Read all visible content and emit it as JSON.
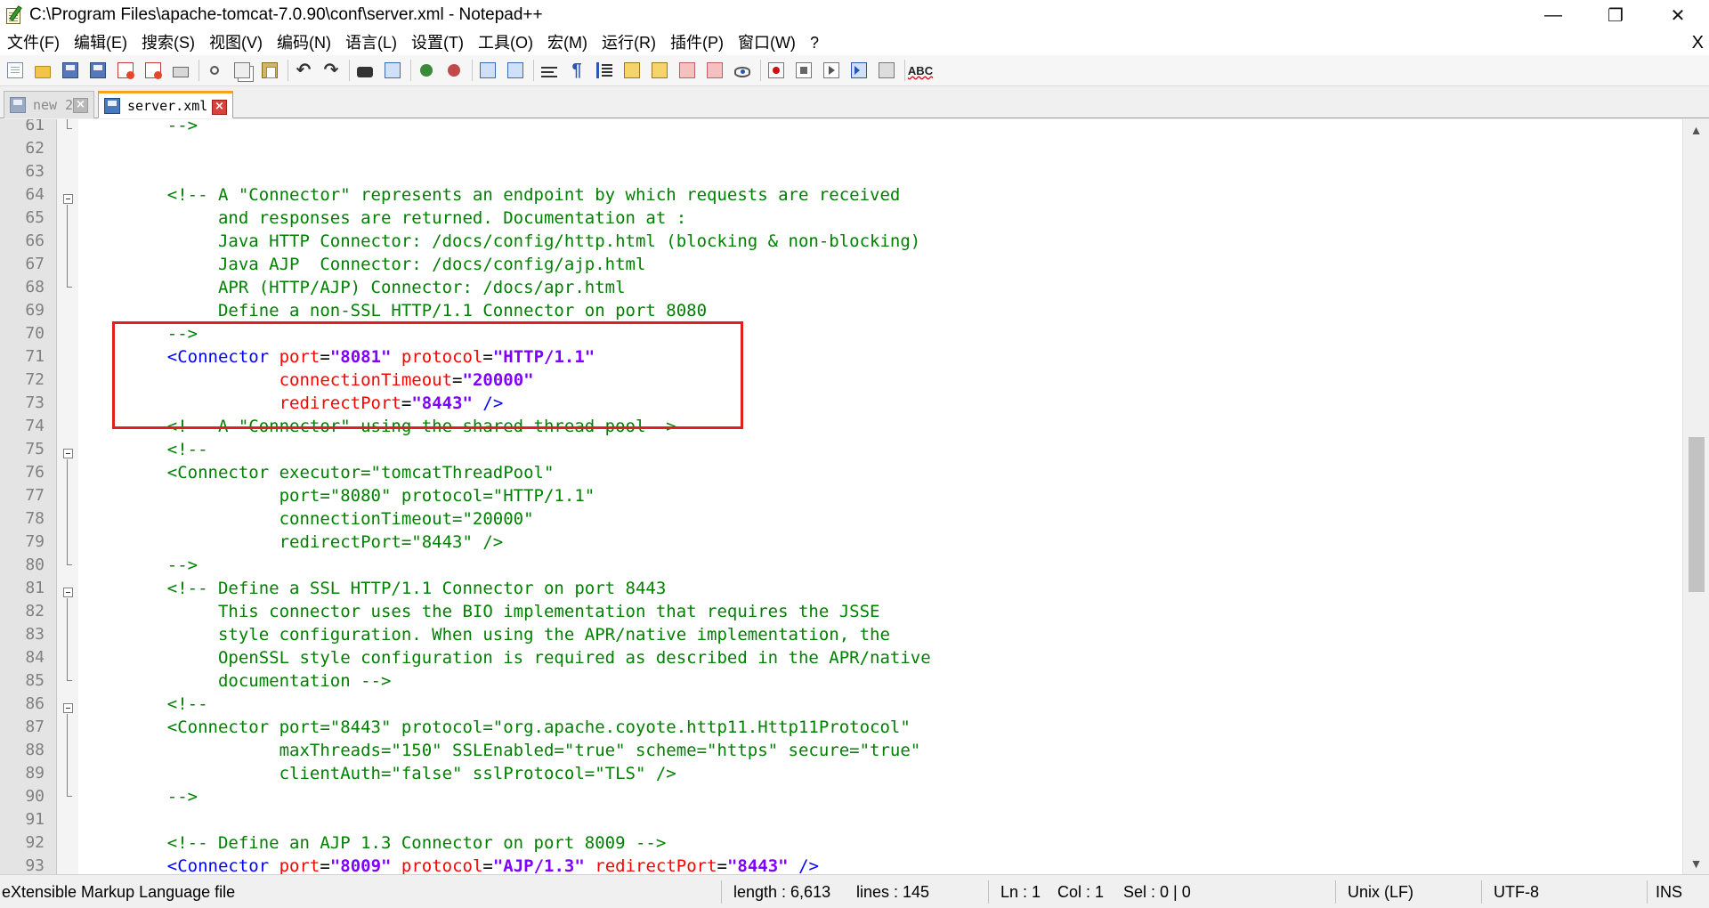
{
  "window": {
    "title": "C:\\Program Files\\apache-tomcat-7.0.90\\conf\\server.xml - Notepad++",
    "minimize": "—",
    "restore": "❐",
    "close": "✕"
  },
  "menu": {
    "items": [
      "文件(F)",
      "编辑(E)",
      "搜索(S)",
      "视图(V)",
      "编码(N)",
      "语言(L)",
      "设置(T)",
      "工具(O)",
      "宏(M)",
      "运行(R)",
      "插件(P)",
      "窗口(W)",
      "?"
    ],
    "close": "X"
  },
  "toolbar": {
    "spellcheck_label": "ABC",
    "buttons": [
      "new-file",
      "open-file",
      "save",
      "save-all",
      "close",
      "close-all",
      "print",
      "cut",
      "copy",
      "paste",
      "undo",
      "redo",
      "find",
      "replace",
      "zoom-in",
      "zoom-out",
      "sync-vertical",
      "sync-horizontal",
      "word-wrap",
      "show-all-chars",
      "indent-guide",
      "doc-map",
      "function-list",
      "folder-as-workspace",
      "monitoring",
      "preview",
      "record-macro",
      "stop-recording",
      "play-macro",
      "run-macro-multiple",
      "save-macro",
      "spell-check"
    ]
  },
  "tabs": [
    {
      "label": "new 2",
      "active": false
    },
    {
      "label": "server.xml",
      "active": true
    }
  ],
  "editor": {
    "lines": [
      {
        "n": "61",
        "segs": [
          {
            "t": "    -->",
            "c": "comment"
          }
        ]
      },
      {
        "n": "62",
        "segs": []
      },
      {
        "n": "63",
        "segs": []
      },
      {
        "n": "64",
        "segs": [
          {
            "t": "    <!-- A \"Connector\" represents an endpoint by which requests are received",
            "c": "comment"
          }
        ]
      },
      {
        "n": "65",
        "segs": [
          {
            "t": "         and responses are returned. Documentation at :",
            "c": "comment"
          }
        ]
      },
      {
        "n": "66",
        "segs": [
          {
            "t": "         Java HTTP Connector: /docs/config/http.html (blocking & non-blocking)",
            "c": "comment"
          }
        ]
      },
      {
        "n": "67",
        "segs": [
          {
            "t": "         Java AJP  Connector: /docs/config/ajp.html",
            "c": "comment"
          }
        ]
      },
      {
        "n": "68",
        "segs": [
          {
            "t": "         APR (HTTP/AJP) Connector: /docs/apr.html",
            "c": "comment"
          }
        ]
      },
      {
        "n": "69",
        "segs": [
          {
            "t": "         Define a non-SSL HTTP/1.1 Connector on port 8080",
            "c": "comment"
          }
        ]
      },
      {
        "n": "70",
        "segs": [
          {
            "t": "    -->",
            "c": "comment"
          }
        ]
      },
      {
        "n": "71",
        "segs": [
          {
            "t": "    <Connector",
            "c": "tag"
          },
          {
            "t": " port",
            "c": "attr"
          },
          {
            "t": "=",
            "c": "plain"
          },
          {
            "t": "\"8081\"",
            "c": "val"
          },
          {
            "t": " protocol",
            "c": "attr"
          },
          {
            "t": "=",
            "c": "plain"
          },
          {
            "t": "\"HTTP/1.1\"",
            "c": "val"
          }
        ]
      },
      {
        "n": "72",
        "segs": [
          {
            "t": "               connectionTimeout",
            "c": "attr"
          },
          {
            "t": "=",
            "c": "plain"
          },
          {
            "t": "\"20000\"",
            "c": "val"
          }
        ]
      },
      {
        "n": "73",
        "segs": [
          {
            "t": "               redirectPort",
            "c": "attr"
          },
          {
            "t": "=",
            "c": "plain"
          },
          {
            "t": "\"8443\"",
            "c": "val"
          },
          {
            "t": " />",
            "c": "tag"
          }
        ]
      },
      {
        "n": "74",
        "segs": [
          {
            "t": "    <!-- A \"Connector\" using the shared thread pool-->",
            "c": "comment"
          }
        ]
      },
      {
        "n": "75",
        "segs": [
          {
            "t": "    <!--",
            "c": "comment"
          }
        ]
      },
      {
        "n": "76",
        "segs": [
          {
            "t": "    <Connector executor=\"tomcatThreadPool\"",
            "c": "comment"
          }
        ]
      },
      {
        "n": "77",
        "segs": [
          {
            "t": "               port=\"8080\" protocol=\"HTTP/1.1\"",
            "c": "comment"
          }
        ]
      },
      {
        "n": "78",
        "segs": [
          {
            "t": "               connectionTimeout=\"20000\"",
            "c": "comment"
          }
        ]
      },
      {
        "n": "79",
        "segs": [
          {
            "t": "               redirectPort=\"8443\" />",
            "c": "comment"
          }
        ]
      },
      {
        "n": "80",
        "segs": [
          {
            "t": "    -->",
            "c": "comment"
          }
        ]
      },
      {
        "n": "81",
        "segs": [
          {
            "t": "    <!-- Define a SSL HTTP/1.1 Connector on port 8443",
            "c": "comment"
          }
        ]
      },
      {
        "n": "82",
        "segs": [
          {
            "t": "         This connector uses the BIO implementation that requires the JSSE",
            "c": "comment"
          }
        ]
      },
      {
        "n": "83",
        "segs": [
          {
            "t": "         style configuration. When using the APR/native implementation, the",
            "c": "comment"
          }
        ]
      },
      {
        "n": "84",
        "segs": [
          {
            "t": "         OpenSSL style configuration is required as described in the APR/native",
            "c": "comment"
          }
        ]
      },
      {
        "n": "85",
        "segs": [
          {
            "t": "         documentation -->",
            "c": "comment"
          }
        ]
      },
      {
        "n": "86",
        "segs": [
          {
            "t": "    <!--",
            "c": "comment"
          }
        ]
      },
      {
        "n": "87",
        "segs": [
          {
            "t": "    <Connector port=\"8443\" protocol=\"org.apache.coyote.http11.Http11Protocol\"",
            "c": "comment"
          }
        ]
      },
      {
        "n": "88",
        "segs": [
          {
            "t": "               maxThreads=\"150\" SSLEnabled=\"true\" scheme=\"https\" secure=\"true\"",
            "c": "comment"
          }
        ]
      },
      {
        "n": "89",
        "segs": [
          {
            "t": "               clientAuth=\"false\" sslProtocol=\"TLS\" />",
            "c": "comment"
          }
        ]
      },
      {
        "n": "90",
        "segs": [
          {
            "t": "    -->",
            "c": "comment"
          }
        ]
      },
      {
        "n": "91",
        "segs": []
      },
      {
        "n": "92",
        "segs": [
          {
            "t": "    <!-- Define an AJP 1.3 Connector on port 8009 -->",
            "c": "comment"
          }
        ]
      },
      {
        "n": "93",
        "segs": [
          {
            "t": "    <Connector",
            "c": "tag"
          },
          {
            "t": " port",
            "c": "attr"
          },
          {
            "t": "=",
            "c": "plain"
          },
          {
            "t": "\"8009\"",
            "c": "val"
          },
          {
            "t": " protocol",
            "c": "attr"
          },
          {
            "t": "=",
            "c": "plain"
          },
          {
            "t": "\"AJP/1.3\"",
            "c": "val"
          },
          {
            "t": " redirectPort",
            "c": "attr"
          },
          {
            "t": "=",
            "c": "plain"
          },
          {
            "t": "\"8443\"",
            "c": "val"
          },
          {
            "t": " />",
            "c": "tag"
          }
        ]
      }
    ]
  },
  "status": {
    "file_type": "eXtensible Markup Language file",
    "length": "length : 6,613",
    "lines": "lines : 145",
    "ln": "Ln : 1",
    "col": "Col : 1",
    "sel": "Sel : 0 | 0",
    "eol": "Unix (LF)",
    "encoding": "UTF-8",
    "mode": "INS"
  },
  "colors": {
    "comment": "#008000",
    "tag": "#0000ff",
    "attribute": "#ff0000",
    "value": "#8000ff",
    "highlight_box": "#e02020",
    "active_tab_accent": "#f7a21b"
  }
}
